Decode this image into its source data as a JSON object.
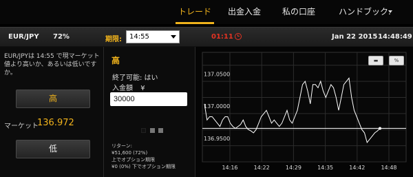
{
  "nav": {
    "items": [
      {
        "label": "トレード",
        "active": true
      },
      {
        "label": "出金入金",
        "active": false
      },
      {
        "label": "私の口座",
        "active": false
      },
      {
        "label": "ハンドブック.",
        "active": false
      }
    ]
  },
  "tradebar": {
    "pair": "EUR/JPY",
    "payout": "72%",
    "expiry_label": "期限:",
    "expiry_value": "14:55",
    "countdown": "01:11",
    "date": "Jan 22 2015",
    "time": "14:48:49"
  },
  "left": {
    "description": "EUR/JPYは 14:55 で現マーケット値より高いか、あるいは低いですか。",
    "high_label": "高",
    "market_label": "マーケット",
    "market_value": "136.972",
    "low_label": "低"
  },
  "middle": {
    "direction": "高",
    "available": "終了可能: はい",
    "deposit_label": "入金額",
    "currency_symbol": "¥",
    "amount": "30000",
    "return_label": "リターン:",
    "return_value": "¥51,600 (72%)",
    "return_note": "上でオプション期限",
    "zero_value": "¥0 (0%) 下でオプション期限"
  },
  "colors": {
    "accent": "#f1b31c",
    "countdown": "#e53322",
    "chart_line": "#ffffff"
  },
  "chart_data": {
    "type": "line",
    "y_ticks": [
      "137.0500",
      "137.0000",
      "136.9500"
    ],
    "x_ticks": [
      "14:16",
      "14:22",
      "14:29",
      "14:35",
      "14:42",
      "14:48"
    ],
    "current_value": 136.972,
    "ylim": [
      136.92,
      137.09
    ],
    "grid": true,
    "series": [
      {
        "values": [
          137.01,
          136.985,
          136.99,
          136.99,
          136.985,
          136.98,
          136.975,
          136.985,
          136.99,
          136.99,
          136.98,
          136.975,
          136.972,
          136.975,
          136.978,
          136.985,
          136.975,
          136.97,
          136.968,
          136.965,
          136.97,
          136.98,
          136.99,
          136.995,
          137.0,
          136.99,
          136.98,
          136.985,
          136.98,
          136.975,
          136.98,
          136.99,
          137.0,
          136.985,
          136.98,
          136.99,
          137.0,
          137.02,
          137.04,
          137.045,
          137.03,
          137.01,
          137.04,
          137.04,
          137.035,
          137.045,
          137.03,
          137.02,
          137.03,
          137.04,
          137.035,
          137.02,
          137.0,
          137.02,
          137.04,
          137.045,
          137.05,
          137.02,
          137.0,
          136.99,
          136.98,
          136.97,
          136.965,
          136.95,
          136.955,
          136.96,
          136.965,
          136.968,
          136.972
        ]
      }
    ]
  }
}
